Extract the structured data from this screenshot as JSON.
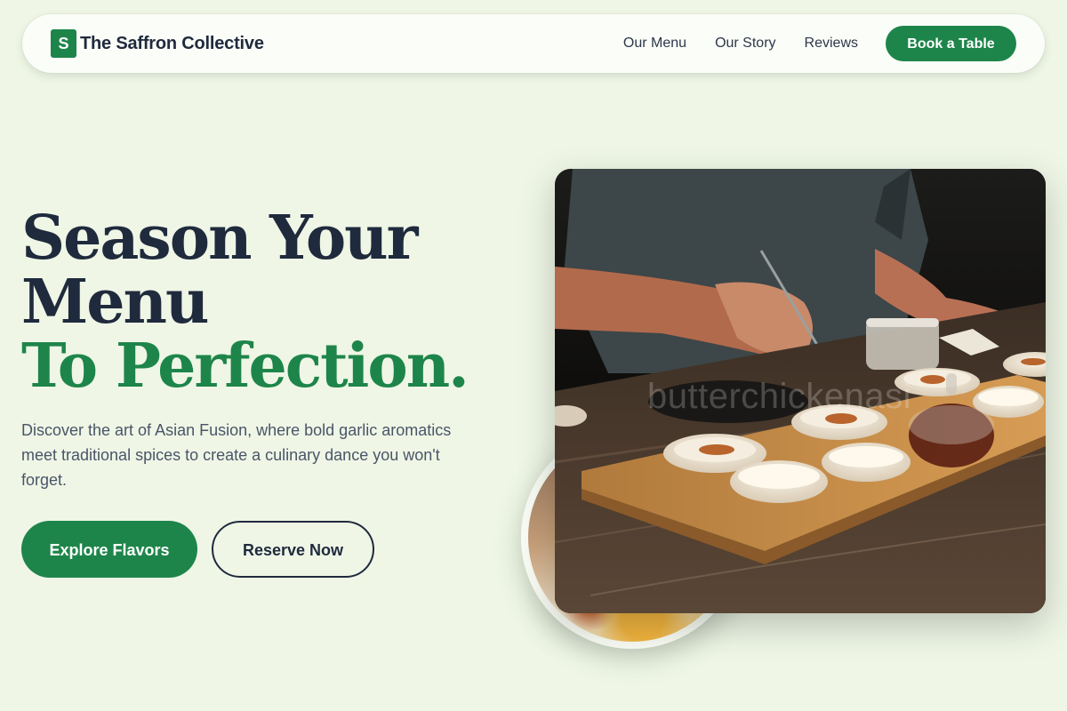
{
  "nav": {
    "logo_letter": "S",
    "brand": "The Saffron Collective",
    "links": [
      "Our Menu",
      "Our Story",
      "Reviews"
    ],
    "cta": "Book a Table"
  },
  "hero": {
    "headline_line1": "Season Your",
    "headline_line2": "Menu",
    "headline_accent": "To Perfection.",
    "description": "Discover the art of Asian Fusion, where bold garlic aromatics meet traditional spices to create a culinary dance you won't forget.",
    "primary_cta": "Explore Flavors",
    "secondary_cta": "Reserve Now",
    "photo_watermark": "butterchickenasi"
  },
  "colors": {
    "accent": "#1e854a",
    "ink": "#1f2a3d",
    "background": "#eff6e6"
  }
}
